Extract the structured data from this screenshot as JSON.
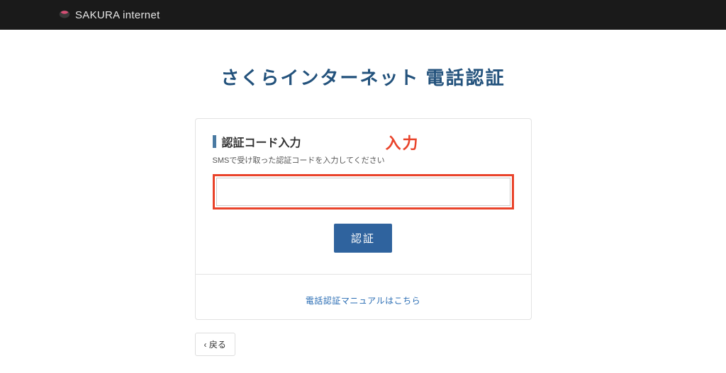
{
  "header": {
    "brand": "SAKURA internet"
  },
  "page": {
    "title": "さくらインターネット 電話認証"
  },
  "form": {
    "section_title": "認証コード入力",
    "help": "SMSで受け取った認証コードを入力してください",
    "code_value": "",
    "submit_label": "認証"
  },
  "annotation": {
    "label": "入力",
    "color": "#e9432a"
  },
  "links": {
    "manual": "電話認証マニュアルはこちら"
  },
  "nav": {
    "back": "‹ 戻る"
  }
}
